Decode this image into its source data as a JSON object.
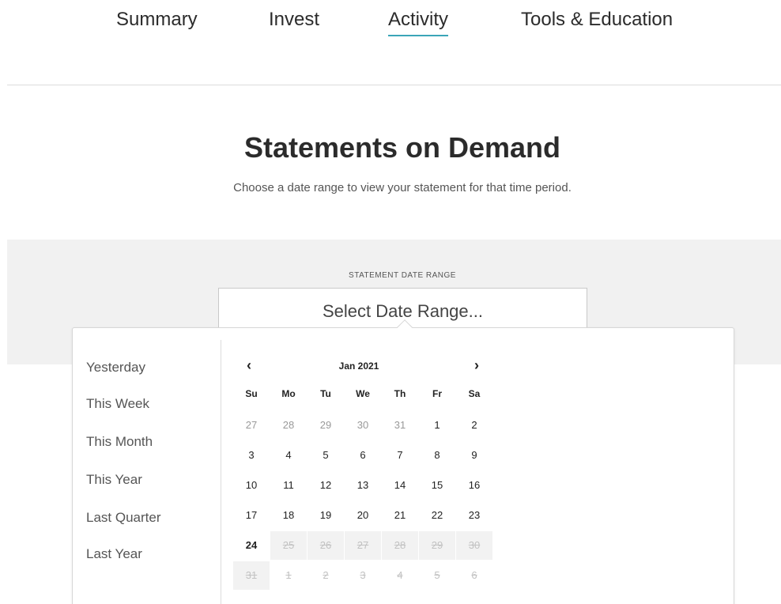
{
  "nav": {
    "items": [
      "Summary",
      "Invest",
      "Activity",
      "Tools & Education"
    ],
    "active": "Activity"
  },
  "page": {
    "title": "Statements on Demand",
    "subtitle": "Choose a date range to view your statement for that time period."
  },
  "date_range": {
    "label": "STATEMENT DATE RANGE",
    "placeholder": "Select Date Range..."
  },
  "presets": [
    "Yesterday",
    "This Week",
    "This Month",
    "This Year",
    "Last Quarter",
    "Last Year"
  ],
  "calendar": {
    "month_label": "Jan 2021",
    "prev_icon": "‹",
    "next_icon": "›",
    "weekdays": [
      "Su",
      "Mo",
      "Tu",
      "We",
      "Th",
      "Fr",
      "Sa"
    ],
    "weeks": [
      [
        "27",
        "28",
        "29",
        "30",
        "31",
        "1",
        "2"
      ],
      [
        "3",
        "4",
        "5",
        "6",
        "7",
        "8",
        "9"
      ],
      [
        "10",
        "11",
        "12",
        "13",
        "14",
        "15",
        "16"
      ],
      [
        "17",
        "18",
        "19",
        "20",
        "21",
        "22",
        "23"
      ],
      [
        "24",
        "25",
        "26",
        "27",
        "28",
        "29",
        "30"
      ],
      [
        "31",
        "1",
        "2",
        "3",
        "4",
        "5",
        "6"
      ]
    ],
    "today": "24",
    "accent_color": "#3aa5b8"
  }
}
